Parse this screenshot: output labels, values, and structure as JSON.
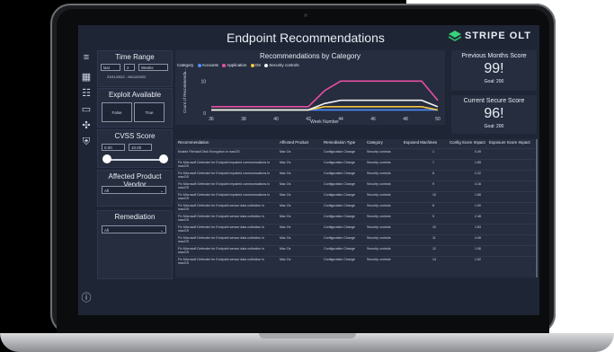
{
  "header": {
    "title": "Endpoint Recommendations",
    "brand": "STRIPE OLT"
  },
  "filters": {
    "time_range": {
      "title": "Time Range",
      "mode": "last",
      "count": "2",
      "unit": "Weeks",
      "date_range": "23/11/2022 - 06/12/2022"
    },
    "exploit": {
      "title": "Exploit Available",
      "options": [
        "False",
        "True"
      ]
    },
    "cvss": {
      "title": "CVSS Score",
      "min": "0.00",
      "max": "10.00"
    },
    "vendor": {
      "title": "Affected Product Vendor",
      "value": "All"
    },
    "remediation": {
      "title": "Remediation",
      "value": "All"
    }
  },
  "cards": {
    "prev": {
      "title": "Previous Months Score",
      "value": "99!",
      "goal": "Goal: 200"
    },
    "current": {
      "title": "Current Secure Score",
      "value": "96!",
      "goal": "Goal: 200"
    }
  },
  "chart_data": {
    "type": "line",
    "title": "Recommendations by Category",
    "legend_label": "Category",
    "xlabel": "Week Number",
    "ylabel": "Count of Recommenda...",
    "x": [
      36,
      37,
      38,
      39,
      40,
      41,
      42,
      43,
      44,
      45,
      46,
      47,
      48,
      49,
      50
    ],
    "x_ticks": [
      36,
      38,
      40,
      42,
      44,
      46,
      48,
      50
    ],
    "y_ticks": [
      0,
      10
    ],
    "ylim": [
      0,
      14
    ],
    "series": [
      {
        "name": "Accounts",
        "color": "#4e8cff",
        "values": [
          1,
          1,
          1,
          1,
          1,
          1,
          1,
          1,
          1,
          1,
          1,
          1,
          1,
          1,
          1
        ]
      },
      {
        "name": "Application",
        "color": "#e84fa2",
        "values": [
          2,
          2,
          2,
          2,
          2,
          2,
          2,
          7,
          10,
          10,
          10,
          10,
          10,
          10,
          4
        ]
      },
      {
        "name": "OS",
        "color": "#f5c542",
        "values": [
          1,
          1,
          1,
          1,
          1,
          1,
          1,
          2,
          2,
          2,
          2,
          2,
          2,
          2,
          1
        ]
      },
      {
        "name": "Security controls",
        "color": "#f2f2f2",
        "values": [
          1,
          1,
          1,
          1,
          1,
          1,
          1,
          3,
          4,
          4,
          4,
          4,
          4,
          4,
          2
        ]
      }
    ]
  },
  "table": {
    "columns": [
      "Recommendation",
      "Affected Product",
      "Remediation Type",
      "Category",
      "Exposed Machines",
      "Config Score Impact",
      "Exposure Score Impact"
    ],
    "rows": [
      [
        "Enable FileVault Disk Encryption in macOS",
        "Mac Os",
        "Configuration Change",
        "Security controls",
        "1",
        "0.49",
        ""
      ],
      [
        "Fix Microsoft Defender for Endpoint impaired communications in macOS",
        "Mac Os",
        "Configuration Change",
        "Security controls",
        "7",
        "1.85",
        ""
      ],
      [
        "Fix Microsoft Defender for Endpoint impaired communications in macOS",
        "Mac Os",
        "Configuration Change",
        "Security controls",
        "8",
        "2.22",
        ""
      ],
      [
        "Fix Microsoft Defender for Endpoint impaired communications in macOS",
        "Mac Os",
        "Configuration Change",
        "Security controls",
        "9",
        "4.16",
        ""
      ],
      [
        "Fix Microsoft Defender for Endpoint impaired communications in macOS",
        "Mac Os",
        "Configuration Change",
        "Security controls",
        "10",
        "1.66",
        ""
      ],
      [
        "Fix Microsoft Defender for Endpoint sensor data collection in macOS",
        "Mac Os",
        "Configuration Change",
        "Security controls",
        "8",
        "1.50",
        ""
      ],
      [
        "Fix Microsoft Defender for Endpoint sensor data collection in macOS",
        "Mac Os",
        "Configuration Change",
        "Security controls",
        "9",
        "2.48",
        ""
      ],
      [
        "Fix Microsoft Defender for Endpoint sensor data collection in macOS",
        "Mac Os",
        "Configuration Change",
        "Security controls",
        "10",
        "1.83",
        ""
      ],
      [
        "Fix Microsoft Defender for Endpoint sensor data collection in macOS",
        "Mac Os",
        "Configuration Change",
        "Security controls",
        "11",
        "4.06",
        ""
      ],
      [
        "Fix Microsoft Defender for Endpoint sensor data collection in macOS",
        "Mac Os",
        "Configuration Change",
        "Security controls",
        "12",
        "1.06",
        ""
      ],
      [
        "Fix Microsoft Defender for Endpoint sensor data collection in macOS",
        "Mac Os",
        "Configuration Change",
        "Security controls",
        "14",
        "1.52",
        ""
      ]
    ]
  }
}
